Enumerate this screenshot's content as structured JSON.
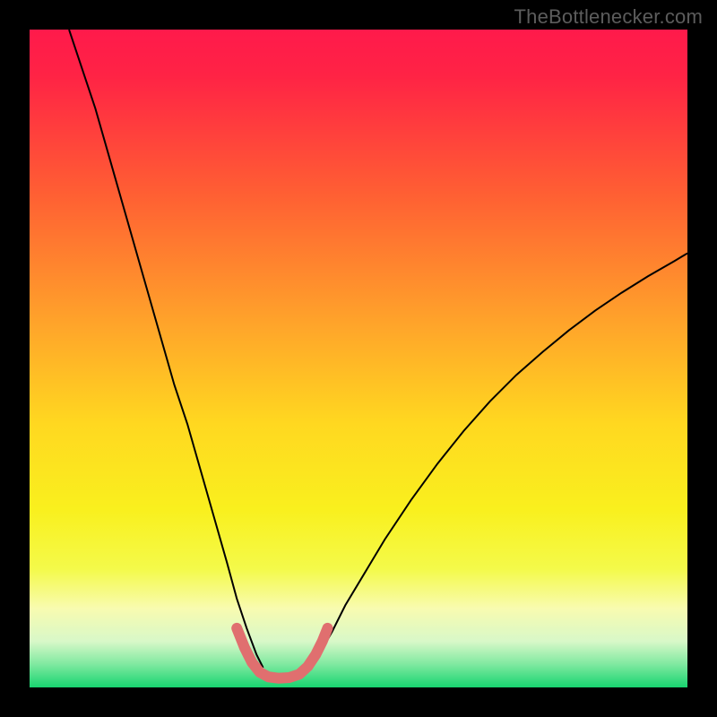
{
  "watermark": "TheBottlenecker.com",
  "chart_data": {
    "type": "line",
    "title": "",
    "xlabel": "",
    "ylabel": "",
    "xlim": [
      0,
      100
    ],
    "ylim": [
      0,
      100
    ],
    "grid": false,
    "background_gradient_stops": [
      {
        "offset": 0,
        "color": "#ff1a4b"
      },
      {
        "offset": 0.07,
        "color": "#ff2345"
      },
      {
        "offset": 0.25,
        "color": "#ff5f33"
      },
      {
        "offset": 0.45,
        "color": "#ffa52a"
      },
      {
        "offset": 0.6,
        "color": "#ffd820"
      },
      {
        "offset": 0.73,
        "color": "#f9f01e"
      },
      {
        "offset": 0.82,
        "color": "#f4fa4a"
      },
      {
        "offset": 0.88,
        "color": "#f8fbb0"
      },
      {
        "offset": 0.93,
        "color": "#d8f8c8"
      },
      {
        "offset": 0.965,
        "color": "#7fe9a0"
      },
      {
        "offset": 1.0,
        "color": "#18d470"
      }
    ],
    "series": [
      {
        "name": "left-curve",
        "stroke": "#000000",
        "stroke_width": 2,
        "x": [
          6,
          8,
          10,
          12,
          14,
          16,
          18,
          20,
          22,
          24,
          26,
          28,
          30,
          31.5,
          33,
          34.5,
          35.5
        ],
        "y": [
          100,
          94,
          88,
          81,
          74,
          67,
          60,
          53,
          46,
          40,
          33,
          26,
          19,
          13.5,
          9,
          5,
          3
        ]
      },
      {
        "name": "right-curve",
        "stroke": "#000000",
        "stroke_width": 2,
        "x": [
          42.5,
          44,
          46,
          48,
          51,
          54,
          58,
          62,
          66,
          70,
          74,
          78,
          82,
          86,
          90,
          94,
          98,
          100
        ],
        "y": [
          3,
          5,
          8.5,
          12.5,
          17.5,
          22.5,
          28.5,
          34,
          39,
          43.5,
          47.5,
          51,
          54.3,
          57.3,
          60,
          62.5,
          64.8,
          66
        ]
      },
      {
        "name": "valley-marker",
        "stroke": "#e06f6f",
        "stroke_width": 12,
        "linecap": "round",
        "x": [
          31.5,
          32.7,
          33.8,
          35.0,
          36.3,
          37.8,
          39.5,
          41.0,
          42.3,
          43.5,
          44.5,
          45.3
        ],
        "y": [
          9.0,
          6.0,
          3.8,
          2.3,
          1.6,
          1.4,
          1.5,
          2.0,
          3.2,
          5.0,
          7.0,
          9.0
        ]
      }
    ],
    "note": "x and y are on a 0–100 scale mapped to the inner plot box; y=0 is bottom."
  }
}
